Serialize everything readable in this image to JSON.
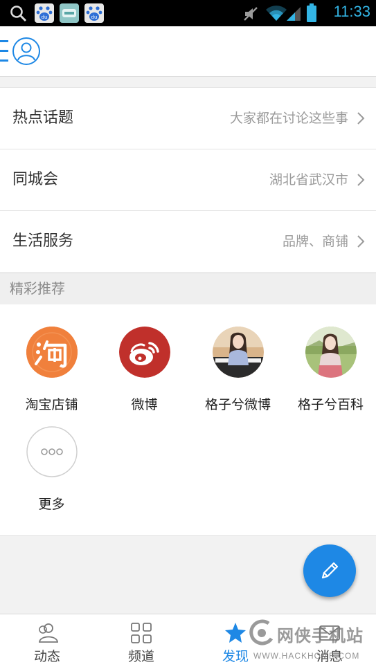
{
  "status_bar": {
    "time": "11:33",
    "left_icons": [
      "search-icon",
      "baidu-paw-icon",
      "app-icon",
      "baidu-paw-icon"
    ],
    "right_icons": [
      "mute-icon",
      "wifi-icon",
      "signal-icon",
      "battery-icon"
    ],
    "accent": "#33b5e5"
  },
  "top_bar": {
    "icons": [
      "menu-icon",
      "user-avatar-icon"
    ]
  },
  "menu": [
    {
      "label": "热点话题",
      "detail": "大家都在讨论这些事"
    },
    {
      "label": "同城会",
      "detail": "湖北省武汉市"
    },
    {
      "label": "生活服务",
      "detail": "品牌、商铺"
    }
  ],
  "recommend": {
    "title": "精彩推荐",
    "items": [
      {
        "label": "淘宝店铺",
        "icon": "taobao-icon"
      },
      {
        "label": "微博",
        "icon": "weibo-icon"
      },
      {
        "label": "格子兮微博",
        "icon": "avatar-photo"
      },
      {
        "label": "格子兮百科",
        "icon": "avatar-photo"
      },
      {
        "label": "更多",
        "icon": "more-icon"
      }
    ]
  },
  "fab": {
    "icon": "pencil-icon",
    "color": "#1e88e5"
  },
  "bottom_nav": {
    "items": [
      {
        "label": "动态",
        "icon": "people-icon",
        "active": false
      },
      {
        "label": "频道",
        "icon": "grid-icon",
        "active": false
      },
      {
        "label": "发现",
        "icon": "star-icon",
        "active": true
      },
      {
        "label": "消息",
        "icon": "mail-icon",
        "active": false
      }
    ],
    "active_color": "#1e88e5"
  },
  "watermark": {
    "text": "网侠手机站",
    "url": "WWW.HACKHOME.COM"
  }
}
